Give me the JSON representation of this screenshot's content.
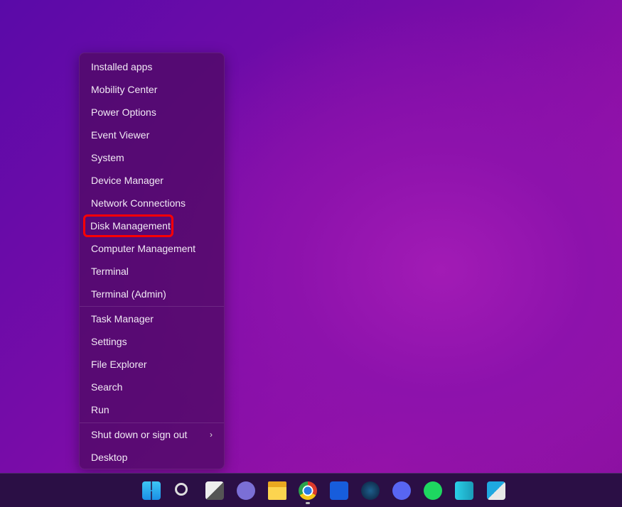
{
  "menu": {
    "group1": [
      "Installed apps",
      "Mobility Center",
      "Power Options",
      "Event Viewer",
      "System",
      "Device Manager",
      "Network Connections",
      "Disk Management",
      "Computer Management",
      "Terminal",
      "Terminal (Admin)"
    ],
    "group2": [
      "Task Manager",
      "Settings",
      "File Explorer",
      "Search",
      "Run"
    ],
    "shutdown": "Shut down or sign out",
    "desktop": "Desktop",
    "highlighted": "Disk Management",
    "highlight_color": "#ff0000"
  },
  "taskbar": {
    "icons": [
      "windows-start-icon",
      "search-icon",
      "task-view-icon",
      "teams-chat-icon",
      "file-explorer-icon",
      "chrome-icon",
      "bitwarden-icon",
      "steam-icon",
      "discord-icon",
      "spotify-icon",
      "buildings-app-icon",
      "video-editor-icon"
    ],
    "active": "chrome-icon"
  }
}
